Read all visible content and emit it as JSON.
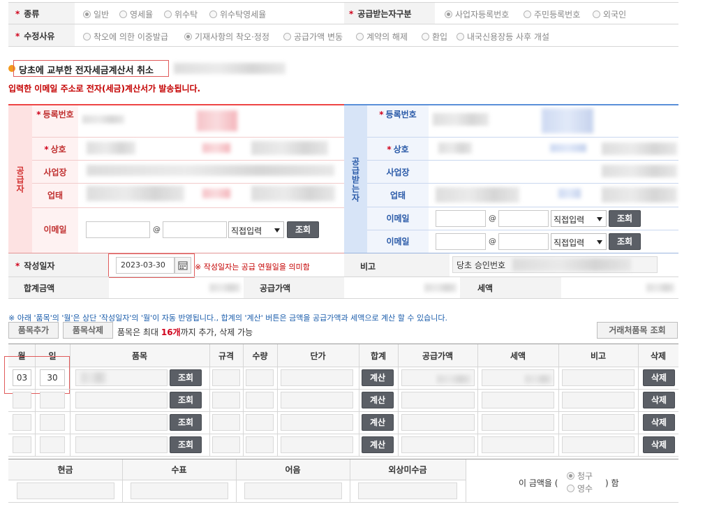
{
  "form": {
    "type_label": "종류",
    "type_options": [
      "일반",
      "영세율",
      "위수탁",
      "위수탁영세율"
    ],
    "recipient_label": "공급받는자구분",
    "recipient_options": [
      "사업자등록번호",
      "주민등록번호",
      "외국인"
    ],
    "reason_label": "수정사유",
    "reason_options": [
      "착오에 의한 이중발급",
      "기재사항의 착오·정정",
      "공급가액 변동",
      "계약의 해제",
      "환입",
      "내국신용장등 사후 개설"
    ]
  },
  "section": {
    "title": "당초에 교부한 전자세금계산서 취소",
    "notice": "입력한 이메일 주소로 전자(세금)계산서가 발송됩니다."
  },
  "supplier": {
    "side_label": "공급자",
    "reg_no_label": "등록번호",
    "name_label": "상호",
    "address_label": "사업장",
    "business_label": "업태",
    "email_label": "이메일",
    "email_at": "@",
    "domain_select": "직접입력",
    "lookup_button": "조회"
  },
  "receiver": {
    "side_label": "공급받는자",
    "reg_no_label": "등록번호",
    "name_label": "상호",
    "address_label": "사업장",
    "business_label": "업태",
    "email1_label": "이메일",
    "email2_label": "이메일",
    "email_at": "@",
    "domain_select": "직접입력",
    "lookup_button": "조회"
  },
  "date": {
    "label": "작성일자",
    "value": "2023-03-30",
    "hint": "※ 작성일자는 공급 연월일을 의미함",
    "note_label": "비고",
    "note_value": "당초 승인번호"
  },
  "totals": {
    "total_label": "합계금액",
    "supply_label": "공급가액",
    "tax_label": "세액"
  },
  "items": {
    "notice": "※ 아래 '품목'의 '월'은 상단 '작성일자'의 '월'이 자동 반영됩니다., 합계의 '계산' 버튼은 금액을 공급가액과 세액으로 계산 할 수 있습니다.",
    "add_button": "품목추가",
    "delete_button": "품목삭제",
    "limit_prefix": "품목은 최대 ",
    "limit_count": "16개",
    "limit_suffix": "까지 추가, 삭제 가능",
    "partner_lookup": "거래처품목 조회",
    "headers": [
      "월",
      "일",
      "품목",
      "규격",
      "수량",
      "단가",
      "합계",
      "공급가액",
      "세액",
      "비고",
      "삭제"
    ],
    "rows": [
      {
        "month": "03",
        "day": "30",
        "lookup": "조회",
        "calc": "계산",
        "delete": "삭제"
      },
      {
        "month": "",
        "day": "",
        "lookup": "조회",
        "calc": "계산",
        "delete": "삭제"
      },
      {
        "month": "",
        "day": "",
        "lookup": "조회",
        "calc": "계산",
        "delete": "삭제"
      },
      {
        "month": "",
        "day": "",
        "lookup": "조회",
        "calc": "계산",
        "delete": "삭제"
      }
    ]
  },
  "payment": {
    "headers": [
      "현금",
      "수표",
      "어음",
      "외상미수금"
    ],
    "amount_prefix": "이 금액을 (",
    "amount_suffix": ") 함",
    "options": [
      "청구",
      "영수"
    ]
  }
}
